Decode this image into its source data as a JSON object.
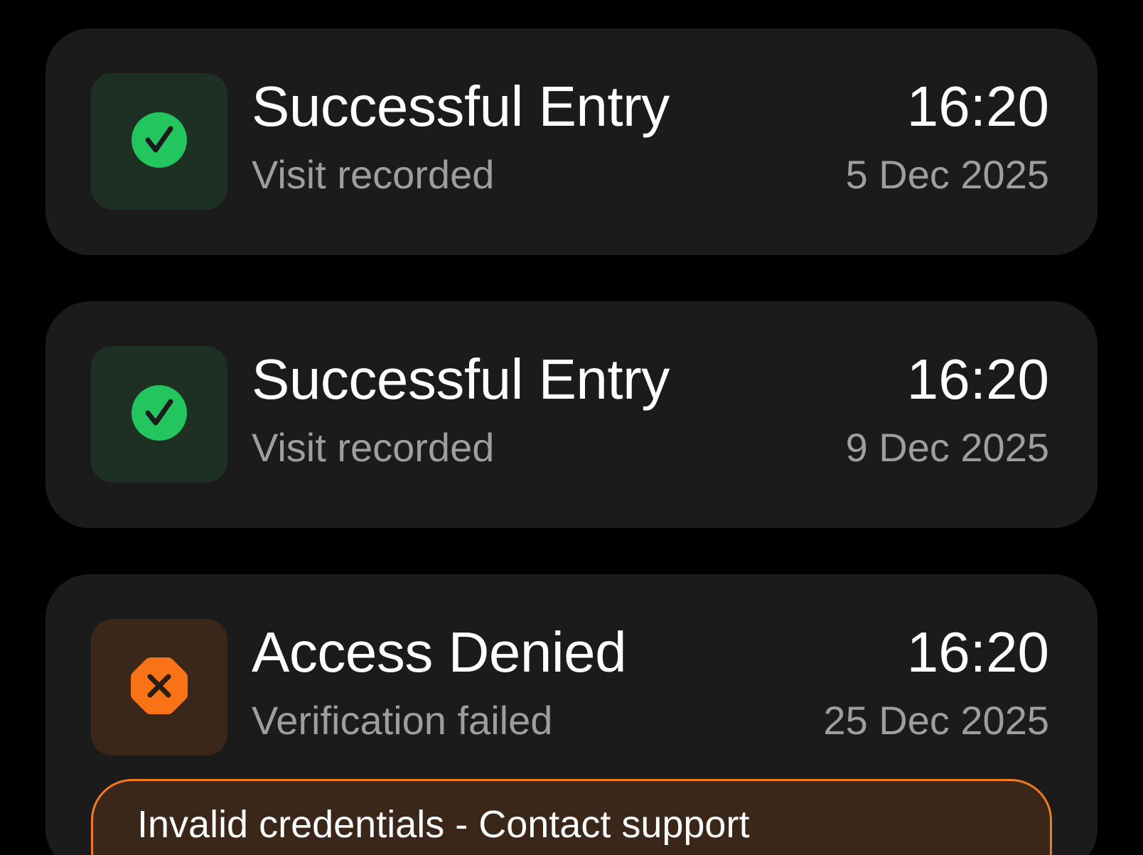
{
  "colors": {
    "background": "#000000",
    "card": "#1b1b1b",
    "success_accent": "#22c55e",
    "success_tile": "#1d3023",
    "denied_accent": "#f97316",
    "denied_tile": "#3b2719",
    "secondary_text": "#9e9e9e"
  },
  "entries": [
    {
      "status": "success",
      "icon": "check-circle-icon",
      "title": "Successful Entry",
      "subtitle": "Visit recorded",
      "time": "16:20",
      "date": "5 Dec 2025"
    },
    {
      "status": "success",
      "icon": "check-circle-icon",
      "title": "Successful Entry",
      "subtitle": "Visit recorded",
      "time": "16:20",
      "date": "9 Dec 2025"
    },
    {
      "status": "denied",
      "icon": "octagon-x-icon",
      "title": "Access Denied",
      "subtitle": "Verification failed",
      "time": "16:20",
      "date": "25 Dec 2025",
      "error_message": "Invalid credentials - Contact support"
    }
  ]
}
